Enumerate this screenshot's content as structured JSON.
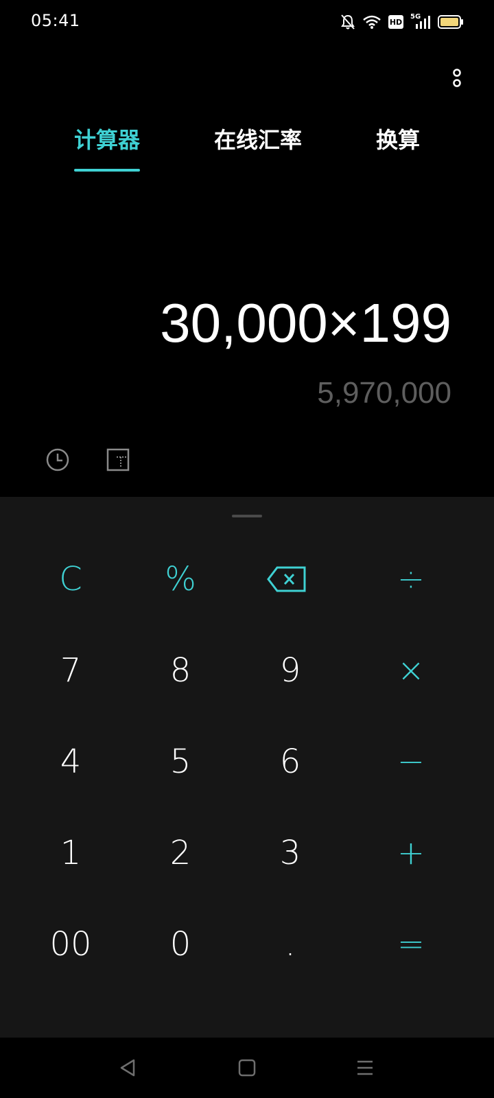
{
  "status_bar": {
    "time": "05:41",
    "icons": [
      "bell-muted-icon",
      "wifi-icon",
      "hd-icon",
      "5g-signal-icon",
      "battery-icon"
    ],
    "hd_label": "HD",
    "network_label": "5G"
  },
  "tabs": [
    {
      "label": "计算器",
      "active": true
    },
    {
      "label": "在线汇率",
      "active": false
    },
    {
      "label": "换算",
      "active": false
    }
  ],
  "display": {
    "expression": "30,000×199",
    "result": "5,970,000"
  },
  "keypad": {
    "row1": [
      "C",
      "%",
      "backspace-icon",
      "÷"
    ],
    "row2": [
      "7",
      "8",
      "9",
      "×"
    ],
    "row3": [
      "4",
      "5",
      "6",
      "−"
    ],
    "row4": [
      "1",
      "2",
      "3",
      "+"
    ],
    "row5": [
      "00",
      "0",
      ".",
      "="
    ]
  },
  "colors": {
    "accent": "#3fd1d3",
    "background": "#000000",
    "keypad_background": "#161616",
    "result_text": "#5e5e5e"
  }
}
